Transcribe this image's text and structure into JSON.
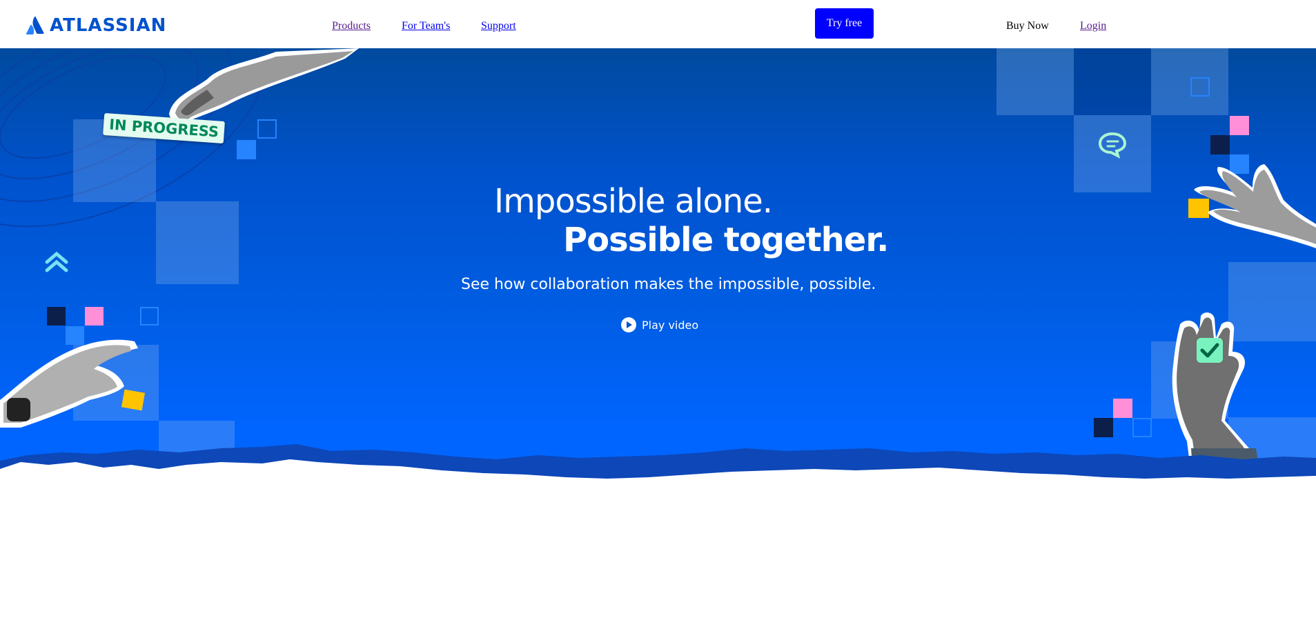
{
  "header": {
    "logo_text": "ATLASSIAN",
    "nav": [
      "Products",
      "For Team's",
      "Support"
    ],
    "try_free": "Try free",
    "buy_now": "Buy Now",
    "login": "Login"
  },
  "hero": {
    "line1": "Impossible alone.",
    "line2": "Possible together.",
    "subhead": "See how collaboration makes the impossible, possible.",
    "play_label": "Play video",
    "badge": "IN PROGRESS"
  },
  "colors": {
    "brand": "#0052cc",
    "hero_top": "#004a9e",
    "hero_bottom": "#0066ff",
    "button": "#0000ff",
    "accent_pink": "#ff8fd8",
    "accent_yellow": "#ffc400",
    "accent_green": "#00875a"
  }
}
